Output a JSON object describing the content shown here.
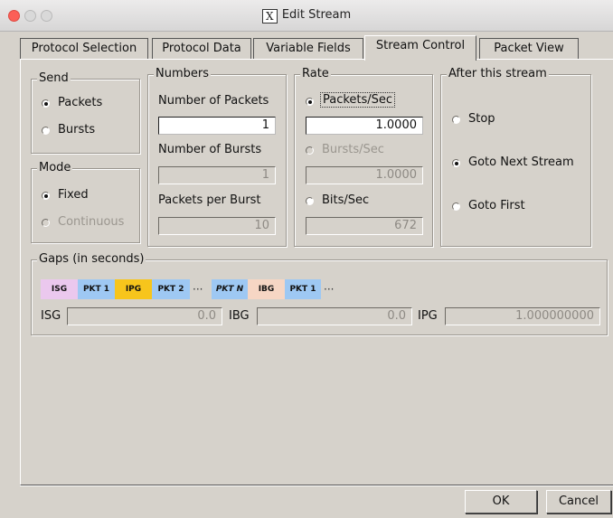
{
  "window": {
    "title": "Edit Stream"
  },
  "tabs": [
    {
      "label": "Protocol Selection"
    },
    {
      "label": "Protocol Data"
    },
    {
      "label": "Variable Fields"
    },
    {
      "label": "Stream Control",
      "active": true
    },
    {
      "label": "Packet View"
    }
  ],
  "send": {
    "title": "Send",
    "options": [
      {
        "label": "Packets",
        "checked": true
      },
      {
        "label": "Bursts",
        "checked": false
      }
    ]
  },
  "mode": {
    "title": "Mode",
    "options": [
      {
        "label": "Fixed",
        "checked": true
      },
      {
        "label": "Continuous",
        "checked": false,
        "disabled": true
      }
    ]
  },
  "numbers": {
    "title": "Numbers",
    "num_packets_label": "Number of Packets",
    "num_packets_value": "1",
    "num_bursts_label": "Number of Bursts",
    "num_bursts_value": "1",
    "packets_per_burst_label": "Packets per Burst",
    "packets_per_burst_value": "10"
  },
  "rate": {
    "title": "Rate",
    "packets_sec_label": "Packets/Sec",
    "packets_sec_value": "1.0000",
    "bursts_sec_label": "Bursts/Sec",
    "bursts_sec_value": "1.0000",
    "bits_sec_label": "Bits/Sec",
    "bits_sec_value": "672"
  },
  "after": {
    "title": "After this stream",
    "options": [
      {
        "label": "Stop",
        "checked": false
      },
      {
        "label": "Goto Next Stream",
        "checked": true
      },
      {
        "label": "Goto First",
        "checked": false
      }
    ]
  },
  "gaps": {
    "title": "Gaps (in seconds)",
    "diagram": [
      "ISG",
      "PKT 1",
      "IPG",
      "PKT 2",
      "···",
      "PKT N",
      "IBG",
      "PKT 1",
      "···"
    ],
    "isg_label": "ISG",
    "isg_value": "0.0",
    "ibg_label": "IBG",
    "ibg_value": "0.0",
    "ipg_label": "IPG",
    "ipg_value": "1.000000000"
  },
  "buttons": {
    "ok": "OK",
    "cancel": "Cancel"
  }
}
